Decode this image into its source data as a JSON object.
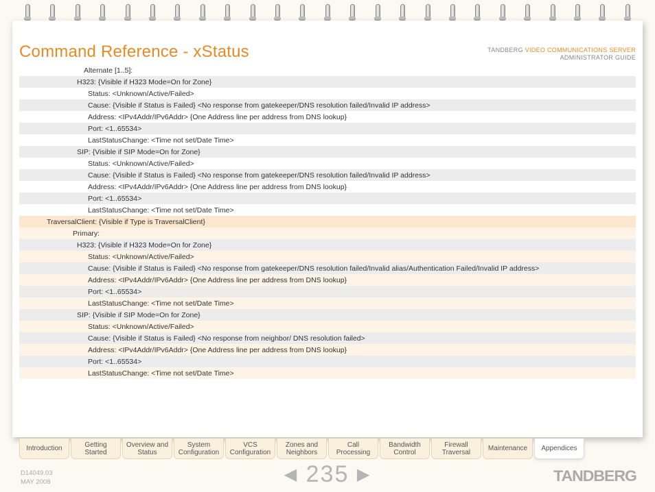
{
  "header": {
    "title": "Command Reference - xStatus",
    "brand_upper": "TANDBERG",
    "product": "VIDEO COMMUNICATIONS SERVER",
    "subtitle": "ADMINISTRATOR GUIDE"
  },
  "rows": [
    {
      "indent": "i0",
      "shade": "white",
      "text": "Alternate [1..5]:"
    },
    {
      "indent": "i1",
      "shade": "grey",
      "text": "H323: {Visible if H323 Mode=On for Zone}"
    },
    {
      "indent": "i2",
      "shade": "white",
      "text": "Status: <Unknown/Active/Failed>"
    },
    {
      "indent": "i2",
      "shade": "grey",
      "text": "Cause: {Visible if Status is Failed} <No response from gatekeeper/DNS resolution failed/Invalid IP address>"
    },
    {
      "indent": "i2",
      "shade": "white",
      "text": "Address: <IPv4Addr/IPv6Addr> {One Address line per address from DNS lookup}"
    },
    {
      "indent": "i2",
      "shade": "grey",
      "text": "Port: <1..65534>"
    },
    {
      "indent": "i2",
      "shade": "white",
      "text": "LastStatusChange: <Time not set/Date Time>"
    },
    {
      "indent": "i1",
      "shade": "grey",
      "text": "SIP: {Visible if SIP Mode=On for Zone}"
    },
    {
      "indent": "i2",
      "shade": "white",
      "text": "Status: <Unknown/Active/Failed>"
    },
    {
      "indent": "i2",
      "shade": "grey",
      "text": "Cause: {Visible if Status is Failed} <No response from gatekeeper/DNS resolution failed/Invalid IP address>"
    },
    {
      "indent": "i2",
      "shade": "white",
      "text": "Address: <IPv4Addr/IPv6Addr> {One Address line per address from DNS lookup}"
    },
    {
      "indent": "i2",
      "shade": "grey",
      "text": "Port: <1..65534>"
    },
    {
      "indent": "i2",
      "shade": "white",
      "text": "LastStatusChange: <Time not set/Date Time>"
    },
    {
      "indent": "i3",
      "shade": "peach",
      "text": "TraversalClient: {Visible if Type is TraversalClient}"
    },
    {
      "indent": "iPrim",
      "shade": "cream",
      "text": "Primary:"
    },
    {
      "indent": "i1",
      "shade": "grey",
      "text": "H323: {Visible if H323 Mode=On for Zone}"
    },
    {
      "indent": "i2",
      "shade": "cream",
      "text": "Status: <Unknown/Active/Failed>"
    },
    {
      "indent": "i2",
      "shade": "grey",
      "text": "Cause: {Visible if Status is Failed} <No response from gatekeeper/DNS resolution failed/Invalid alias/Authentication Failed/Invalid IP address>"
    },
    {
      "indent": "i2",
      "shade": "cream",
      "text": "Address: <IPv4Addr/IPv6Addr> {One Address line per address from DNS lookup}"
    },
    {
      "indent": "i2",
      "shade": "grey",
      "text": "Port: <1..65534>"
    },
    {
      "indent": "i2",
      "shade": "cream",
      "text": "LastStatusChange: <Time not set/Date Time>"
    },
    {
      "indent": "i1",
      "shade": "grey",
      "text": "SIP: {Visible if SIP Mode=On for Zone}"
    },
    {
      "indent": "i2",
      "shade": "cream",
      "text": "Status: <Unknown/Active/Failed>"
    },
    {
      "indent": "i2",
      "shade": "grey",
      "text": "Cause: {Visible if Status is Failed} <No response from neighbor/ DNS resolution failed>"
    },
    {
      "indent": "i2",
      "shade": "cream",
      "text": "Address: <IPv4Addr/IPv6Addr> {One Address line per address from DNS lookup}"
    },
    {
      "indent": "i2",
      "shade": "grey",
      "text": "Port: <1..65534>"
    },
    {
      "indent": "i2",
      "shade": "cream",
      "text": "LastStatusChange: <Time not set/Date Time>"
    }
  ],
  "tabs": [
    {
      "label": "Introduction",
      "active": false
    },
    {
      "label": "Getting Started",
      "active": false
    },
    {
      "label": "Overview and Status",
      "active": false
    },
    {
      "label": "System Configuration",
      "active": false
    },
    {
      "label": "VCS Configuration",
      "active": false
    },
    {
      "label": "Zones and Neighbors",
      "active": false
    },
    {
      "label": "Call Processing",
      "active": false
    },
    {
      "label": "Bandwidth Control",
      "active": false
    },
    {
      "label": "Firewall Traversal",
      "active": false
    },
    {
      "label": "Maintenance",
      "active": false
    },
    {
      "label": "Appendices",
      "active": true
    }
  ],
  "footer": {
    "docid": "D14049.03",
    "date": "MAY 2008",
    "page": "235",
    "brand": "TANDBERG"
  }
}
